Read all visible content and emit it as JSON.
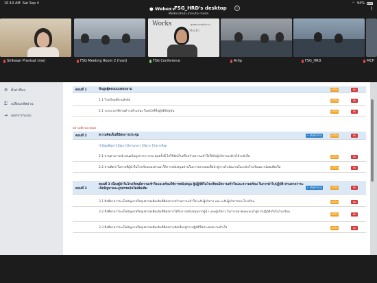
{
  "status": {
    "time": "10:10 AM",
    "date": "Sat Sep 4",
    "battery": "94%"
  },
  "meeting": {
    "app": "Webex",
    "host_desktop": "FSG_HRD's desktop",
    "mode": "Moderated unmute mode"
  },
  "participants": [
    {
      "name": "Sirikwan Pravisat (me)",
      "mic": "muted"
    },
    {
      "name": "FSG Meeting Room 2 (host)",
      "mic": "muted"
    },
    {
      "name": "FSG Conference",
      "mic": "on"
    },
    {
      "name": "Artip",
      "mic": "muted"
    },
    {
      "name": "FSG_HRD",
      "mic": "muted"
    },
    {
      "name": "MCP",
      "mic": "muted"
    }
  ],
  "slide_text": {
    "title": "Works",
    "sub1": "ชุมชนและพนักงาน",
    "sub2": "ไร้ระ  ุ้นิว"
  },
  "sidebar": {
    "items": [
      {
        "label": "ตั้งค่าอื่นๆ",
        "icon": "settings-icon"
      },
      {
        "label": "เปลี่ยนรหัสผ่าน",
        "icon": "key-icon"
      },
      {
        "label": "ออกจากระบบ",
        "icon": "logout-icon"
      }
    ]
  },
  "content": {
    "section1": {
      "no": "ตอนที่ 1",
      "title": "ข้อมูลผู้ตอบแบบสอบถาม",
      "rows": [
        "1.1 โรงเรียนที่ท่านสังกัด",
        "2.1 ระยะเวลาที่ท่านดำรงตำแหน่ง ในหน้าที่ที่ปฏิบัติปัจจุบัน"
      ]
    },
    "note": "อย่างเดียวจะจบลง",
    "section2": {
      "no": "ตอนที่ 2",
      "title": "ความคิดเห็นที่มีต่อการประชุม",
      "add_label": "เพิ่มคำถาม",
      "scale": "[1]น้อยที่สุด [2]น้อย [3]ปานกลาง [4]มาก [5]มากที่สุด",
      "rows": [
        "2.1 ท่านสามารถนำเสนอข้อมูลจากการประชุมครั้งนี้ ไปใช้จัดเก็บหรือสร้างความเข้าใจให้กับผู้บริหารองค์กรได้ระดับใด",
        "2.2 ท่านคิดว่าโอกาสที่ผู้นำในโรงเรียนของท่านจะให้การสนับสนุนท่านในการขยายผลเพื่อนำสู่การดำเนินงานในระดับโรงเรียนมากน้อยเพียงใด"
      ]
    },
    "section3": {
      "no": "ตอนที่ 3",
      "title": "ตอนที่ 3 เนื่องผู้นำในโรงเรียนมีความเข้าใจและพร้อมให้การสนับสนุน ผู้ปฏิบัติในโรงเรียนมีความเข้าใจและความพร้อม ในการนำไปปฏิบัติ ท่านคาดว่าจะเกิดปัญหาและอุปสรรคอันใดเพิ่มเติม",
      "add_label": "เพิ่มคำถาม",
      "rows": [
        "3.1 สิ่งที่คาดว่าจะเป็นปัญหาหรืออุปสรรคเพิ่มเติมที่มีต่อการสร้างความเข้าใจระดับผู้บริหาร และระดับผู้บริหารของโรงเรียน",
        "3.2 สิ่งที่คาดว่าจะเป็นปัญหาหรืออุปสรรคเพิ่มเติมที่มีต่อการได้รับการสนับสนุนจากผู้นำ และผู้บริหาร ในการขยายผลและนำสู่การปฏิบัติจริงในโรงเรียน",
        "3.3 สิ่งที่คาดว่าจะเป็นปัญหาหรืออุปสรรคเพิ่มเติมที่มีต่อการคัดเลือกสู่การปฏิบัติให้ประสบความสำเร็จ"
      ]
    },
    "edit_label": "แก้ไข",
    "delete_label": "ลบ"
  },
  "colors": {
    "section_bg": "#dbe9f6",
    "edit": "#f0a020",
    "delete": "#d23b3b",
    "add": "#2f7fc6"
  }
}
